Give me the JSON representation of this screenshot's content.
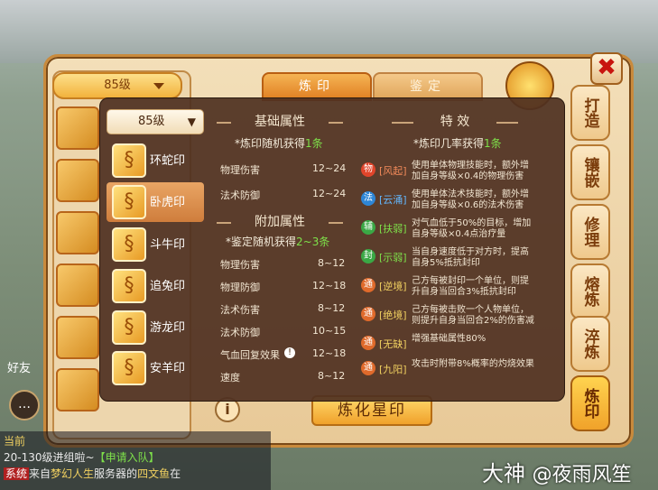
{
  "window": {
    "top_tabs": [
      "炼印",
      "鉴定"
    ],
    "side_tabs": [
      "打造",
      "镶嵌",
      "修理",
      "熔炼",
      "淬炼",
      "炼印"
    ],
    "close_label": "✖",
    "back_level_select": "85级"
  },
  "popup": {
    "level_select": "85级",
    "seals": [
      {
        "name": "环蛇印",
        "icon": "snake-seal-icon",
        "selected": false
      },
      {
        "name": "卧虎印",
        "icon": "tiger-seal-icon",
        "selected": true
      },
      {
        "name": "斗牛印",
        "icon": "ox-seal-icon",
        "selected": false
      },
      {
        "name": "追兔印",
        "icon": "rabbit-seal-icon",
        "selected": false
      },
      {
        "name": "游龙印",
        "icon": "dragon-seal-icon",
        "selected": false
      },
      {
        "name": "安羊印",
        "icon": "sheep-seal-icon",
        "selected": false
      }
    ],
    "basic": {
      "title": "基础属性",
      "tip_prefix": "*炼印随机获得",
      "tip_hl": "1条",
      "attrs": [
        {
          "name": "物理伤害",
          "value": "12~24"
        },
        {
          "name": "法术防御",
          "value": "12~24"
        }
      ]
    },
    "extra": {
      "title": "附加属性",
      "tip_prefix": "*鉴定随机获得",
      "tip_hl": "2~3条",
      "attrs": [
        {
          "name": "物理伤害",
          "value": "8~12"
        },
        {
          "name": "物理防御",
          "value": "12~18"
        },
        {
          "name": "法术伤害",
          "value": "8~12"
        },
        {
          "name": "法术防御",
          "value": "10~15"
        },
        {
          "name": "气血回复效果",
          "value": "12~18"
        },
        {
          "name": "速度",
          "value": "8~12"
        }
      ]
    },
    "effects": {
      "title": "特 效",
      "tip_prefix": "*炼印几率获得",
      "tip_hl": "1条",
      "items": [
        {
          "badge": "物",
          "badge_color": "#e0452b",
          "name": "[风起]",
          "name_color": "#f28a5a",
          "desc": [
            "使用单体物理技能时，额外增",
            "加自身等级×0.4的物理伤害"
          ]
        },
        {
          "badge": "法",
          "badge_color": "#2e86d6",
          "name": "[云涌]",
          "name_color": "#63b8ff",
          "desc": [
            "使用单体法术技能时，额外增",
            "加自身等级×0.6的法术伤害"
          ]
        },
        {
          "badge": "辅",
          "badge_color": "#3aa845",
          "name": "[扶弱]",
          "name_color": "#7ee04a",
          "desc": [
            "对气血低于50%的目标，增加",
            "自身等级×0.4点治疗量"
          ]
        },
        {
          "badge": "封",
          "badge_color": "#3aa845",
          "name": "[示弱]",
          "name_color": "#7ee04a",
          "desc": [
            "当自身速度低于对方时，提高",
            "自身5%抵抗封印"
          ]
        },
        {
          "badge": "通",
          "badge_color": "#e06a2b",
          "name": "[逆境]",
          "name_color": "#f0d060",
          "desc": [
            "己方每被封印一个单位，则提",
            "升自身当回合3%抵抗封印"
          ]
        },
        {
          "badge": "通",
          "badge_color": "#e06a2b",
          "name": "[绝境]",
          "name_color": "#f0d060",
          "desc": [
            "己方每被击败一个人物单位，",
            "则提升自身当回合2%的伤害减"
          ]
        },
        {
          "badge": "通",
          "badge_color": "#e06a2b",
          "name": "[无缺]",
          "name_color": "#f0d060",
          "desc": [
            "增强基础属性80%"
          ]
        },
        {
          "badge": "通",
          "badge_color": "#e06a2b",
          "name": "[九阳]",
          "name_color": "#f0d060",
          "desc": [
            "攻击时附带8%概率的灼烧效果"
          ]
        }
      ]
    }
  },
  "bottom": {
    "info_label": "i",
    "refine_star_button": "炼化星印"
  },
  "chat": {
    "friend_label": "好友",
    "line1_tag": "当前",
    "line2": "20-130级进组啦~",
    "line2_link": "【申请入队】",
    "line3_tag": "系统",
    "line3_text_a": "来自",
    "line3_server": "梦幻人生",
    "line3_text_b": "服务器的",
    "line3_player": "四文鱼",
    "line3_text_c": "在"
  },
  "watermark": {
    "brand": "大神",
    "user": "@夜雨风笙"
  }
}
